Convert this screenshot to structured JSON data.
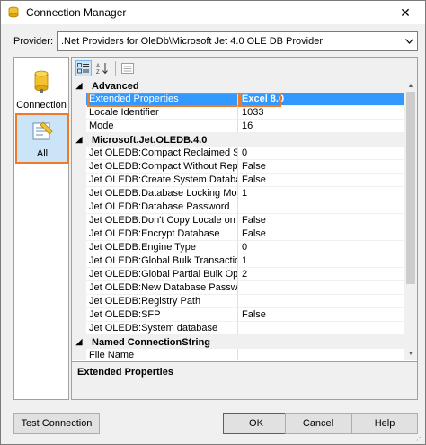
{
  "window": {
    "title": "Connection Manager",
    "close_label": "✕"
  },
  "provider": {
    "label": "Provider:",
    "value": ".Net Providers for OleDb\\Microsoft Jet 4.0 OLE DB Provider"
  },
  "nav": {
    "items": [
      {
        "label": "Connection",
        "icon": "cylinder-database-icon"
      },
      {
        "label": "All",
        "icon": "properties-page-icon",
        "selected": true
      }
    ]
  },
  "toolbar": {
    "buttons": [
      "categorized-icon",
      "alphabetical-sort-icon",
      "property-pages-icon"
    ]
  },
  "grid": {
    "categories": [
      {
        "name": "Advanced",
        "rows": [
          {
            "name": "Extended Properties",
            "value": "Excel 8.0",
            "selected": true
          },
          {
            "name": "Locale Identifier",
            "value": "1033"
          },
          {
            "name": "Mode",
            "value": "16"
          }
        ]
      },
      {
        "name": "Microsoft.Jet.OLEDB.4.0",
        "rows": [
          {
            "name": "Jet OLEDB:Compact Reclaimed Space A",
            "value": "0"
          },
          {
            "name": "Jet OLEDB:Compact Without Replica Re",
            "value": "False"
          },
          {
            "name": "Jet OLEDB:Create System Database",
            "value": "False"
          },
          {
            "name": "Jet OLEDB:Database Locking Mode",
            "value": "1"
          },
          {
            "name": "Jet OLEDB:Database Password",
            "value": ""
          },
          {
            "name": "Jet OLEDB:Don't Copy Locale on Comp",
            "value": "False"
          },
          {
            "name": "Jet OLEDB:Encrypt Database",
            "value": "False"
          },
          {
            "name": "Jet OLEDB:Engine Type",
            "value": "0"
          },
          {
            "name": "Jet OLEDB:Global Bulk Transactions",
            "value": "1"
          },
          {
            "name": "Jet OLEDB:Global Partial Bulk Ops",
            "value": "2"
          },
          {
            "name": "Jet OLEDB:New Database Password",
            "value": ""
          },
          {
            "name": "Jet OLEDB:Registry Path",
            "value": ""
          },
          {
            "name": "Jet OLEDB:SFP",
            "value": "False"
          },
          {
            "name": "Jet OLEDB:System database",
            "value": ""
          }
        ]
      },
      {
        "name": "Named ConnectionString",
        "rows": [
          {
            "name": "File Name",
            "value": ""
          }
        ]
      }
    ]
  },
  "description": {
    "title": "Extended Properties"
  },
  "buttons": {
    "test_connection": "Test Connection",
    "ok": "OK",
    "cancel": "Cancel",
    "help": "Help"
  },
  "colors": {
    "highlight_border": "#ee7a2a",
    "selection": "#3399ff"
  }
}
